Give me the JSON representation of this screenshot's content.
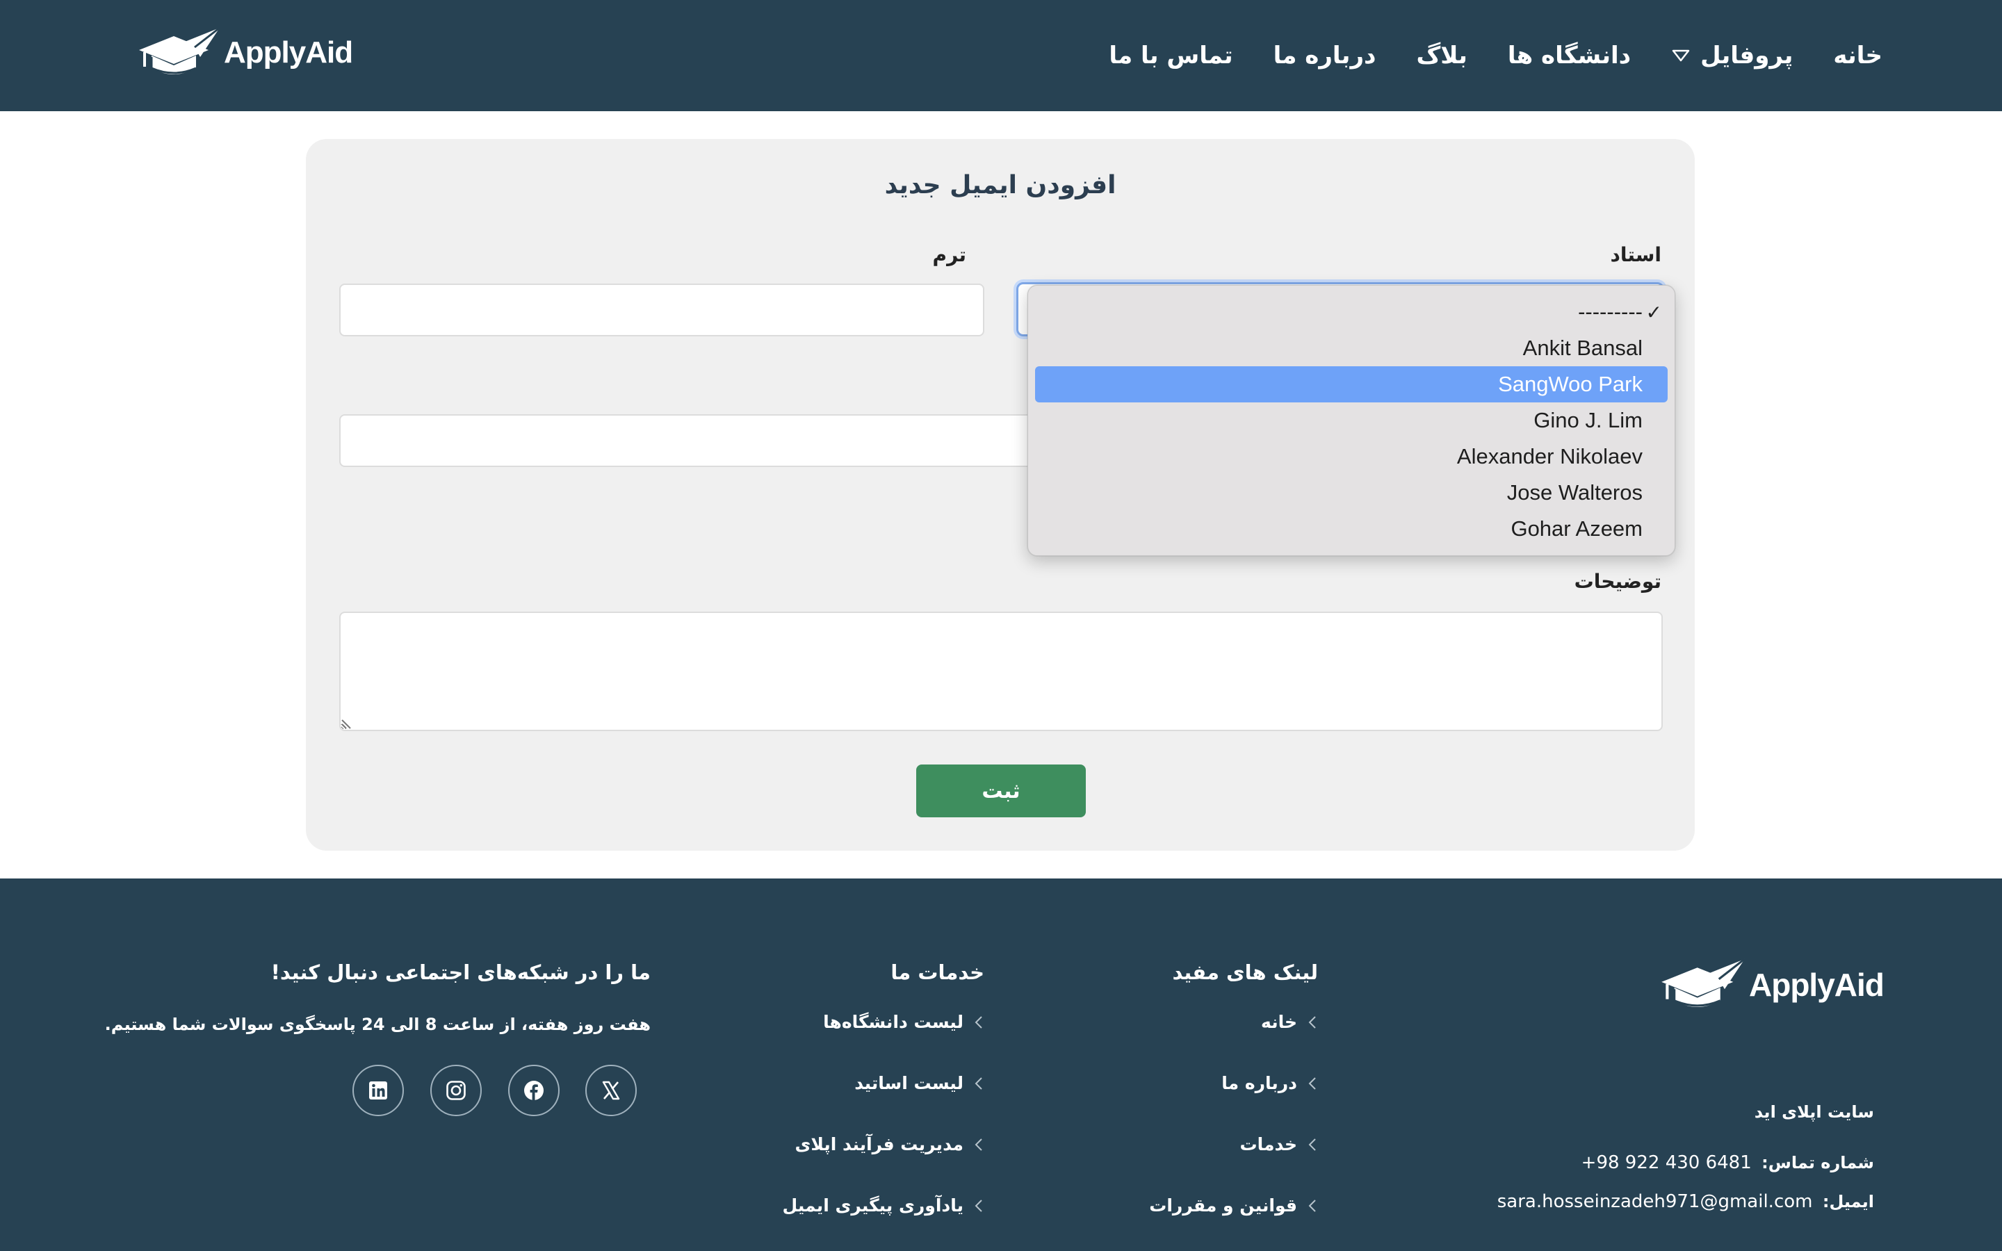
{
  "brand": {
    "name": "ApplyAid"
  },
  "nav": {
    "items": [
      {
        "label": "خانه"
      },
      {
        "label": "پروفایل",
        "has_dropdown": true
      },
      {
        "label": "دانشگاه ها"
      },
      {
        "label": "بلاگ"
      },
      {
        "label": "درباره ما"
      },
      {
        "label": "تماس با ما"
      }
    ]
  },
  "form": {
    "title": "افزودن ایمیل جدید",
    "professor_label": "استاد",
    "term_label": "ترم",
    "term_value": "",
    "second_row_value": "",
    "description_label": "توضیحات",
    "description_value": "",
    "submit_label": "ثبت"
  },
  "dropdown": {
    "options": [
      {
        "label": "---------",
        "checked": true
      },
      {
        "label": "Ankit Bansal"
      },
      {
        "label": "SangWoo Park",
        "highlighted": true
      },
      {
        "label": "Gino J. Lim"
      },
      {
        "label": "Alexander Nikolaev"
      },
      {
        "label": "Jose Walteros"
      },
      {
        "label": "Gohar Azeem"
      }
    ],
    "check_glyph": "✓",
    "highlight_color": "#6ea2f8"
  },
  "footer": {
    "site_name": "سایت اپلای اید",
    "phone_label": "شماره تماس:",
    "phone": "+98 922 430 6481",
    "email_label": "ایمیل:",
    "email": "sara.hosseinzadeh971@gmail.com",
    "useful_links": {
      "heading": "لینک های مفید",
      "items": [
        "خانه",
        "درباره ما",
        "خدمات",
        "قوانین و مقررات"
      ]
    },
    "services": {
      "heading": "خدمات ما",
      "items": [
        "لیست دانشگاه‌ها",
        "لیست اساتید",
        "مدیریت فرآیند اپلای",
        "یادآوری پیگیری ایمیل"
      ]
    },
    "social": {
      "heading": "ما را در شبکه‌های اجتماعی دنبال کنید!",
      "subtext": "هفت روز هفته، از ساعت 8 الی 24 پاسخگوی سوالات شما هستیم.",
      "icons": [
        "x-icon",
        "facebook-icon",
        "instagram-icon",
        "linkedin-icon"
      ]
    }
  },
  "colors": {
    "header_bg": "#274253",
    "footer_bg": "#274253",
    "card_bg": "#f0f0f0",
    "submit_bg": "#3e8e5e",
    "title_color": "#2c3e50"
  }
}
